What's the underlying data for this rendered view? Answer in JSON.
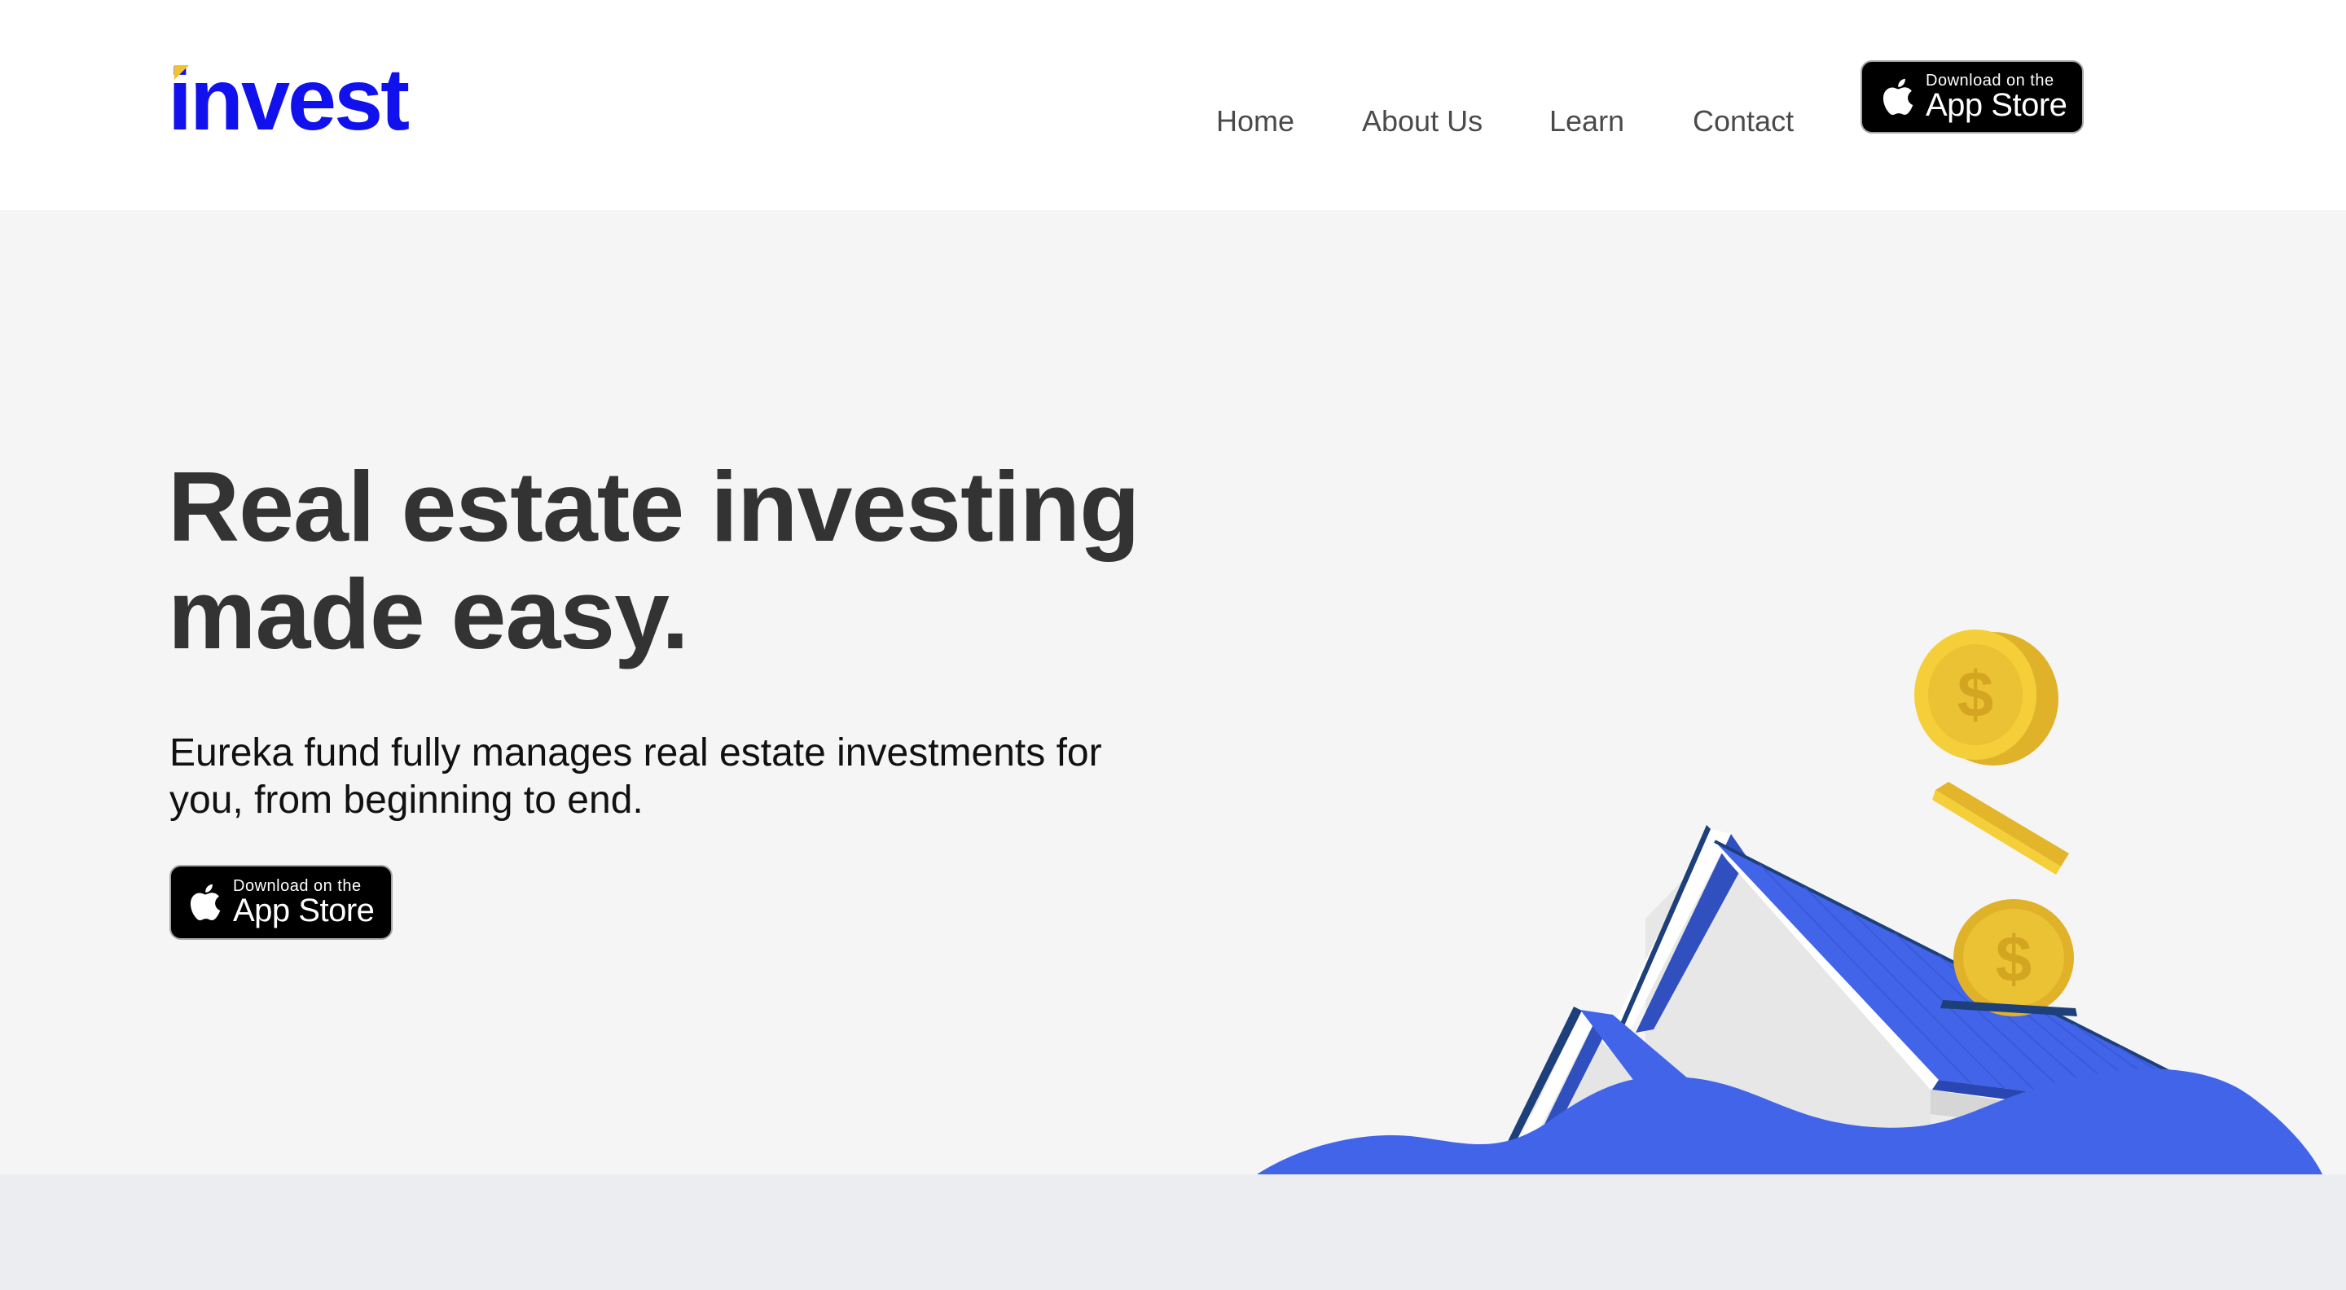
{
  "brand": {
    "logo_text": "invest",
    "color": "#1111ee",
    "accent": "#f2c230"
  },
  "nav": {
    "items": [
      {
        "label": "Home"
      },
      {
        "label": "About Us"
      },
      {
        "label": "Learn"
      },
      {
        "label": "Contact"
      }
    ]
  },
  "app_store_badge": {
    "small_text": "Download on the",
    "large_text": "App Store",
    "icon": "apple-icon"
  },
  "hero": {
    "headline": "Real estate investing made easy.",
    "subtext": "Eureka fund fully manages real estate investments for you, from beginning to end."
  },
  "colors": {
    "hero_bg": "#f5f5f5",
    "house_blue": "#4264e8",
    "coin_gold": "#f2c230",
    "headline": "#333333"
  }
}
